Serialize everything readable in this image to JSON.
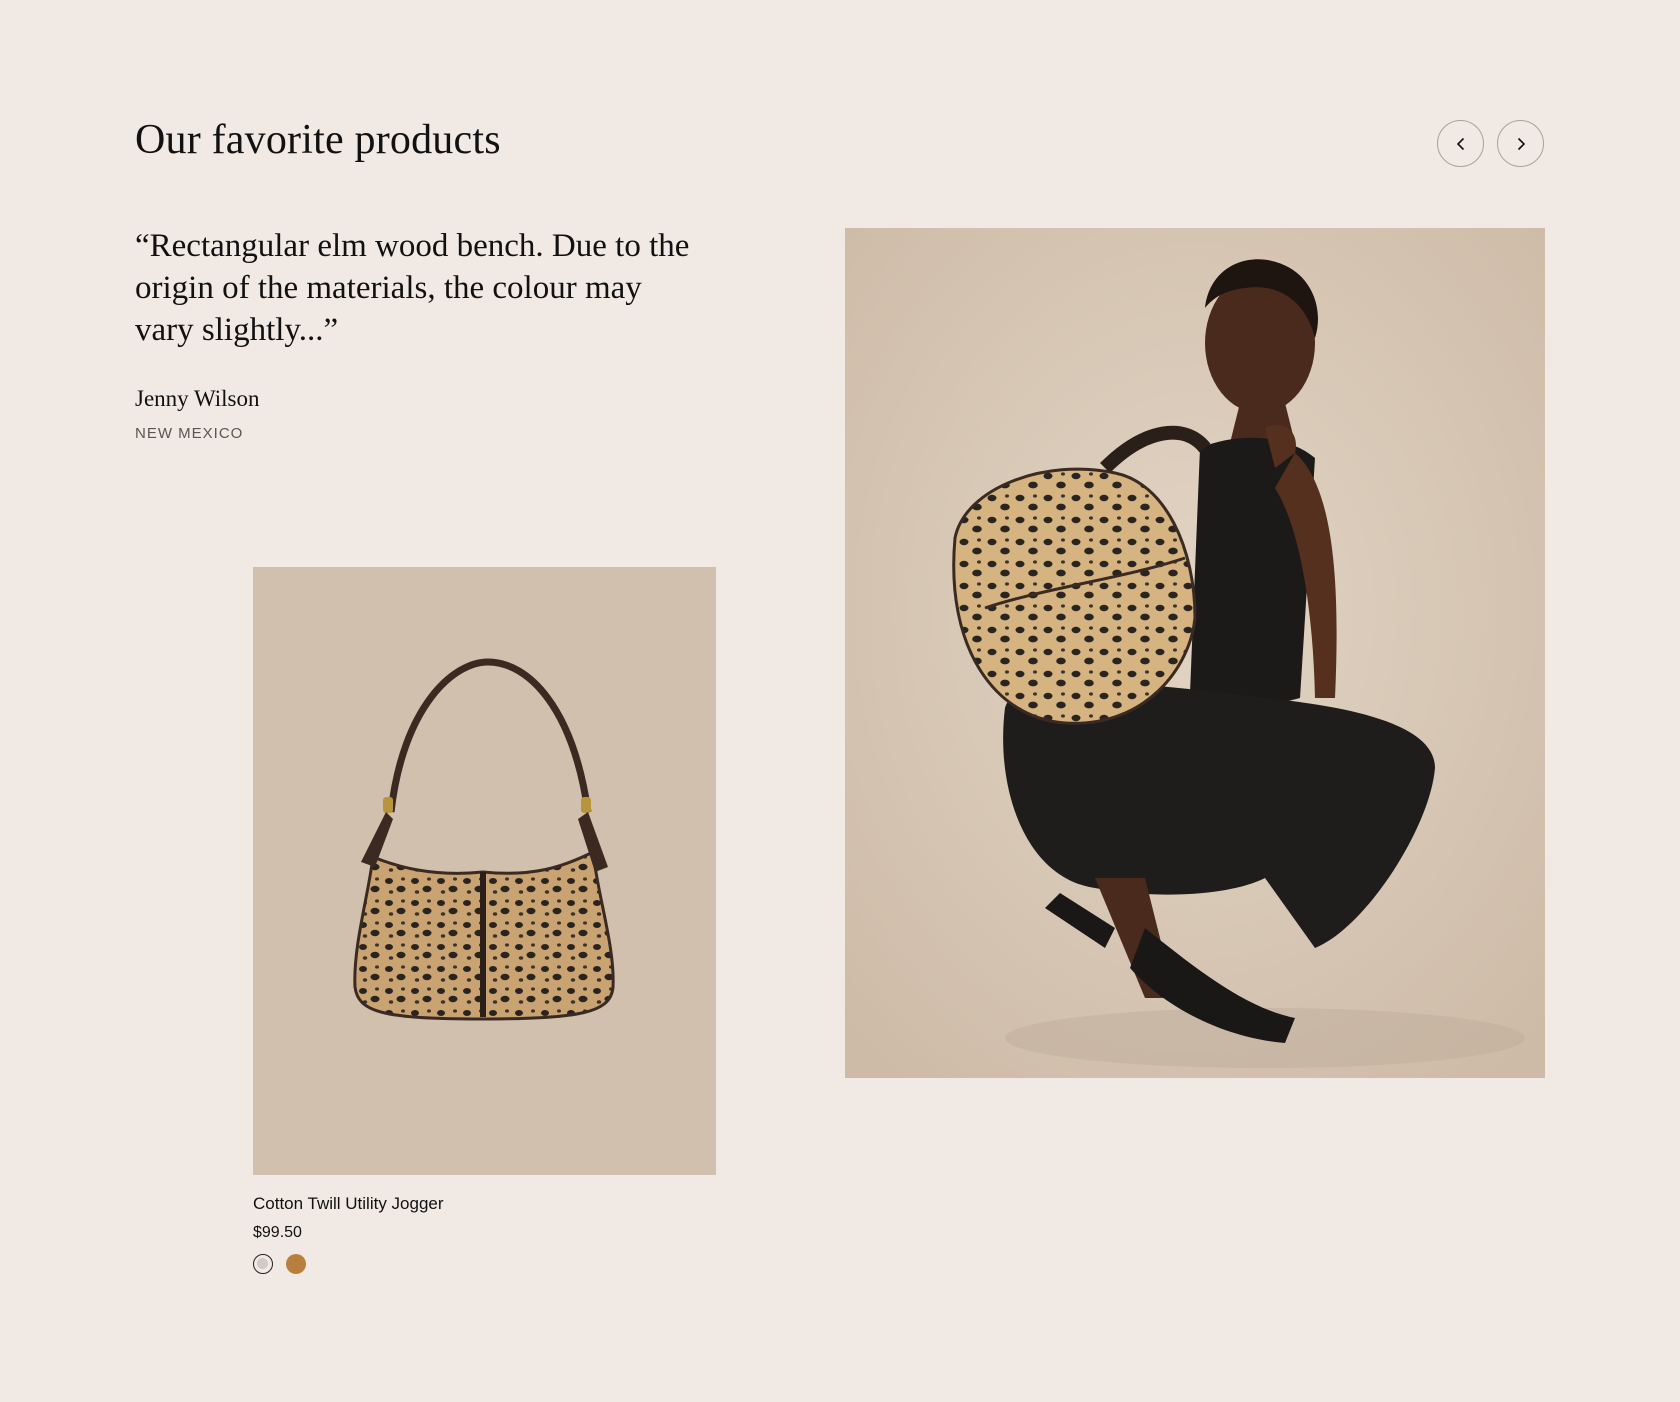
{
  "section": {
    "title": "Our favorite products"
  },
  "nav": {
    "prev_label": "Previous",
    "next_label": "Next"
  },
  "testimonial": {
    "quote": "“Rectangular elm wood bench. Due to the origin of the materials, the colour may vary slightly...”",
    "author": "Jenny Wilson",
    "location": "NEW MEXICO"
  },
  "product": {
    "name": "Cotton Twill Utility Jogger",
    "price": "$99.50",
    "swatches": [
      {
        "color": "#cfccc8",
        "selected": true
      },
      {
        "color": "#b97f3e",
        "selected": false
      }
    ]
  },
  "colors": {
    "background": "#f1e9e3",
    "product_bg": "#d2c0ae",
    "lifestyle_bg": "#d9c9b8"
  }
}
